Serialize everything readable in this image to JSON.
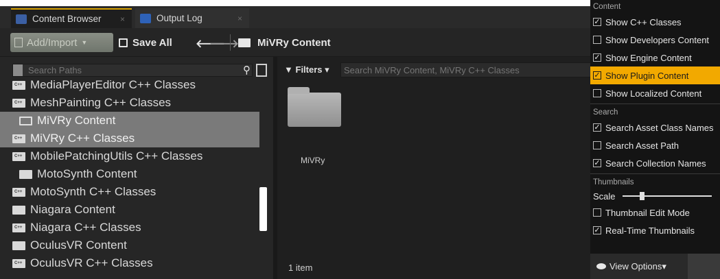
{
  "tabs": [
    {
      "label": "Content Browser",
      "icon": "content-browser-icon",
      "active": true
    },
    {
      "label": "Output Log",
      "icon": "output-log-icon",
      "active": false
    }
  ],
  "toolbar": {
    "add_import_label": "Add/Import",
    "save_all_label": "Save All",
    "breadcrumb": "MiVRy Content"
  },
  "sources": {
    "search_placeholder": "Search Paths",
    "items": [
      {
        "label": "MediaPlayerEditor C++ Classes",
        "type": "cpp"
      },
      {
        "label": "MeshPainting C++ Classes",
        "type": "cpp"
      },
      {
        "label": "MiVRy Content",
        "type": "content",
        "selected": true
      },
      {
        "label": "MiVRy C++ Classes",
        "type": "cpp",
        "selected": true
      },
      {
        "label": "MobilePatchingUtils C++ Classes",
        "type": "cpp"
      },
      {
        "label": "MotoSynth Content",
        "type": "content"
      },
      {
        "label": "MotoSynth C++ Classes",
        "type": "cpp"
      },
      {
        "label": "Niagara Content",
        "type": "content"
      },
      {
        "label": "Niagara C++ Classes",
        "type": "cpp"
      },
      {
        "label": "OculusVR Content",
        "type": "content"
      },
      {
        "label": "OculusVR C++ Classes",
        "type": "cpp"
      }
    ]
  },
  "content": {
    "filters_label": "Filters",
    "search_placeholder": "Search MiVRy Content, MiVRy C++ Classes",
    "assets": [
      {
        "name": "MiVRy"
      }
    ],
    "item_count": "1 item"
  },
  "view_options_menu": {
    "section_content": "Content",
    "content_items": [
      {
        "label": "Show C++ Classes",
        "checked": true
      },
      {
        "label": "Show Developers Content",
        "checked": false
      },
      {
        "label": "Show Engine Content",
        "checked": true
      },
      {
        "label": "Show Plugin Content",
        "checked": true,
        "highlighted": true
      },
      {
        "label": "Show Localized Content",
        "checked": false
      }
    ],
    "section_search": "Search",
    "search_items": [
      {
        "label": "Search Asset Class Names",
        "checked": true
      },
      {
        "label": "Search Asset Path",
        "checked": false
      },
      {
        "label": "Search Collection Names",
        "checked": true
      }
    ],
    "section_thumbnails": "Thumbnails",
    "scale_label": "Scale",
    "scale_value": 0.2,
    "thumbnail_items": [
      {
        "label": "Thumbnail Edit Mode",
        "checked": false
      },
      {
        "label": "Real-Time Thumbnails",
        "checked": true
      }
    ]
  },
  "view_options_label": "View Options",
  "colors": {
    "accent": "#f2a900",
    "selection": "#7a7a7a"
  }
}
